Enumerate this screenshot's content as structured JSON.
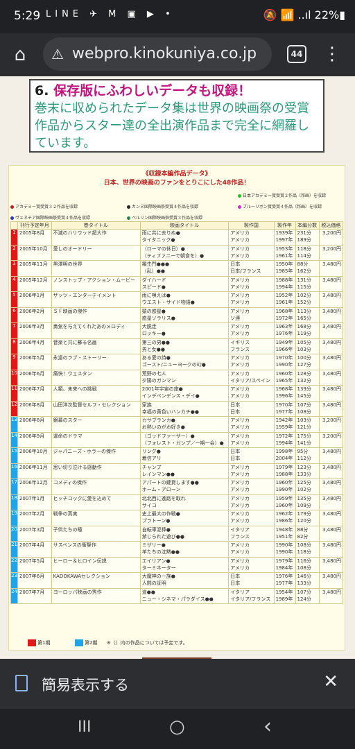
{
  "status": {
    "time": "5:29",
    "apps": "LINE ✈ M ▣ ▶ •",
    "right": "🔕 📶 ..ıl 22%▮"
  },
  "browser": {
    "url": "webpro.kinokuniya.co.jp",
    "tabs": "44"
  },
  "feature": {
    "num": "6.",
    "heading": "保存版にふわしいデータも収録！",
    "body": "巻末に収められたデータ集は世界の映画祭の受賞作品からスター達の全出演作品まで完全に網羅しています。"
  },
  "table": {
    "title1": "《収録本編作品データ》",
    "title2": "日本、世界の映画のファンをとりこにした48作品！",
    "legend": [
      {
        "color": "#22c322",
        "text": "日本アカデミー賞受賞２作品（邦画）を収録"
      },
      {
        "color": "#d01414",
        "text": "アカデミー賞受賞３２作品を収録"
      },
      {
        "color": "#222222",
        "text": "カンヌ国際映画祭受賞４作品を収録"
      },
      {
        "color": "#d02ad0",
        "text": "ブルーリボン賞受賞４作品（邦画）を収録"
      },
      {
        "color": "#1e3cc8",
        "text": "ヴェネチア国際映画祭受賞４作品を収録"
      },
      {
        "color": "#1e8a5a",
        "text": "ベルリン国際映画祭受賞３作品を収録"
      }
    ],
    "headers": [
      "",
      "刊行予定年月",
      "巻タイトル",
      "映画タイトル",
      "製作国",
      "製作年",
      "本編分数",
      "税込価格"
    ],
    "rows": [
      {
        "n": "1",
        "c": "r",
        "date": "2005年8月",
        "vol": "不滅のハリウッド超大作",
        "films": [
          "雨に共に去りぬ●",
          "タイタニック●"
        ],
        "country": [
          "アメリカ",
          "アメリカ"
        ],
        "year": [
          "1939年",
          "1997年"
        ],
        "mins": [
          "231分",
          "189分"
        ],
        "price": "3,200円"
      },
      {
        "n": "2",
        "c": "r",
        "date": "2005年10月",
        "vol": "愛しのオードリー",
        "films": [
          "（ローマの休日）●",
          "（ティファニーで朝食を）●"
        ],
        "country": [
          "アメリカ",
          "アメリカ"
        ],
        "year": [
          "1953年",
          "1961年"
        ],
        "mins": [
          "118分",
          "114分"
        ],
        "price": "3,200円"
      },
      {
        "n": "3",
        "c": "r",
        "date": "2005年11月",
        "vol": "黒澤明の世界",
        "films": [
          "羅生門●●●",
          "（乱）●●"
        ],
        "country": [
          "日本",
          "日本/フランス"
        ],
        "year": [
          "1950年",
          "1985年"
        ],
        "mins": [
          "88分",
          "162分"
        ],
        "price": "3,480円"
      },
      {
        "n": "4",
        "c": "r",
        "date": "2005年12月",
        "vol": "ノンストップ・アクション・ムービー",
        "films": [
          "ダイハード",
          "スピード●"
        ],
        "country": [
          "アメリカ",
          "アメリカ"
        ],
        "year": [
          "1988年",
          "1994年"
        ],
        "mins": [
          "131分",
          "115分"
        ],
        "price": "3,480円"
      },
      {
        "n": "5",
        "c": "r",
        "date": "2006年1月",
        "vol": "ザッツ・エンターテイメント",
        "films": [
          "雨に唄えば●",
          "ウエスト・サイド物語●"
        ],
        "country": [
          "アメリカ",
          "アメリカ"
        ],
        "year": [
          "1952年",
          "1961年"
        ],
        "mins": [
          "102分",
          "152分"
        ],
        "price": "3,480円"
      },
      {
        "n": "6",
        "c": "r",
        "date": "2006年2月",
        "vol": "ＳＦ映画の傑作",
        "films": [
          "猿の惑星●",
          "惑星ソラリス●"
        ],
        "country": [
          "アメリカ",
          "ソ連"
        ],
        "year": [
          "1968年",
          "1972年"
        ],
        "mins": [
          "113分",
          "165分"
        ],
        "price": "3,480円"
      },
      {
        "n": "7",
        "c": "r",
        "date": "2006年3月",
        "vol": "勇気を与えてくれたあのメロディ",
        "films": [
          "大脱走",
          "ロッキー●"
        ],
        "country": [
          "アメリカ",
          "アメリカ"
        ],
        "year": [
          "1963年",
          "1976年"
        ],
        "mins": [
          "168分",
          "119分"
        ],
        "price": "3,480円"
      },
      {
        "n": "8",
        "c": "r",
        "date": "2006年4月",
        "vol": "音楽と共に蘇る名画",
        "films": [
          "第三の男●●",
          "男と女●●"
        ],
        "country": [
          "イギリス",
          "フランス"
        ],
        "year": [
          "1949年",
          "1966年"
        ],
        "mins": [
          "105分",
          "103分"
        ],
        "price": "3,480円"
      },
      {
        "n": "9",
        "c": "r",
        "date": "2006年5月",
        "vol": "永遠のラブ・ストーリー",
        "films": [
          "ある愛の詩●",
          "ゴースト/ニューヨークの幻●"
        ],
        "country": [
          "アメリカ",
          "アメリカ"
        ],
        "year": [
          "1970年",
          "1990年"
        ],
        "mins": [
          "100分",
          "127分"
        ],
        "price": "3,480円"
      },
      {
        "n": "10",
        "c": "r",
        "date": "2006年6月",
        "vol": "痛快！ウェスタン",
        "films": [
          "荒野の七人",
          "夕陽のガンマン"
        ],
        "country": [
          "アメリカ",
          "イタリア/スペイン"
        ],
        "year": [
          "1960年",
          "1965年"
        ],
        "mins": [
          "128分",
          "132分"
        ],
        "price": "3,480円"
      },
      {
        "n": "11",
        "c": "r",
        "date": "2006年7月",
        "vol": "人類、未来への挑戦",
        "films": [
          "2001年宇宙の旅●",
          "インデペンデンス・デイ●"
        ],
        "country": [
          "アメリカ",
          "アメリカ"
        ],
        "year": [
          "1968年",
          "1996年"
        ],
        "mins": [
          "139分",
          "145分"
        ],
        "price": "3,480円"
      },
      {
        "n": "12",
        "c": "r",
        "date": "2006年8月",
        "vol": "山田洋次監督セルフ・セレクション",
        "films": [
          "家族",
          "幸福の黄色いハンカチ●●"
        ],
        "country": [
          "日本",
          "日本"
        ],
        "year": [
          "1970年",
          "1977年"
        ],
        "mins": [
          "107分",
          "108分"
        ],
        "price": "3,480円"
      },
      {
        "n": "13",
        "c": "b",
        "date": "2006年8月",
        "vol": "銀幕のスター",
        "films": [
          "カサブランカ●",
          "お熱いのがお好き●"
        ],
        "country": [
          "アメリカ",
          "アメリカ"
        ],
        "year": [
          "1942年",
          "1959年"
        ],
        "mins": [
          "103分",
          "121分"
        ],
        "price": "3,200円"
      },
      {
        "n": "14",
        "c": "b",
        "date": "2006年9月",
        "vol": "運命のドラマ",
        "films": [
          "（ゴッドファーザー）●",
          "（フォレスト・ガンプ／一期一会）●"
        ],
        "country": [
          "アメリカ",
          "アメリカ"
        ],
        "year": [
          "1972年",
          "1994年"
        ],
        "mins": [
          "175分",
          "141分"
        ],
        "price": "3,200円"
      },
      {
        "n": "15",
        "c": "b",
        "date": "2006年10月",
        "vol": "ジャパニーズ・ホラーの傑作",
        "films": [
          "リング●",
          "着信アリ"
        ],
        "country": [
          "日本",
          "日本"
        ],
        "year": [
          "1998年",
          "2004年"
        ],
        "mins": [
          "95分",
          "112分"
        ],
        "price": "3,480円"
      },
      {
        "n": "16",
        "c": "b",
        "date": "2006年11月",
        "vol": "思い切り泣ける感動作",
        "films": [
          "チャンプ",
          "レインマン●●"
        ],
        "country": [
          "アメリカ",
          "アメリカ"
        ],
        "year": [
          "1979年",
          "1988年"
        ],
        "mins": [
          "123分",
          "133分"
        ],
        "price": "3,480円"
      },
      {
        "n": "17",
        "c": "b",
        "date": "2006年12月",
        "vol": "コメディの傑作",
        "films": [
          "アパートの鍵貸します●●",
          "ホーム・アローン"
        ],
        "country": [
          "アメリカ",
          "アメリカ"
        ],
        "year": [
          "1960年",
          "1990年"
        ],
        "mins": [
          "125分",
          "102分"
        ],
        "price": "3,480円"
      },
      {
        "n": "18",
        "c": "b",
        "date": "2007年1月",
        "vol": "ヒッチコックに愛を込めて",
        "films": [
          "北北西に進路を取れ",
          "サイコ"
        ],
        "country": [
          "アメリカ",
          "アメリカ"
        ],
        "year": [
          "1959年",
          "1960年"
        ],
        "mins": [
          "135分",
          "109分"
        ],
        "price": "3,480円"
      },
      {
        "n": "19",
        "c": "b",
        "date": "2007年2月",
        "vol": "戦争の真実",
        "films": [
          "史上最大の作戦●",
          "プラトーン●"
        ],
        "country": [
          "アメリカ",
          "アメリカ"
        ],
        "year": [
          "1962年",
          "1986年"
        ],
        "mins": [
          "179分",
          "120分"
        ],
        "price": "3,480円"
      },
      {
        "n": "20",
        "c": "b",
        "date": "2007年3月",
        "vol": "子供たちの瞳",
        "films": [
          "自転車泥棒●",
          "禁じられた遊び●●"
        ],
        "country": [
          "イタリア",
          "フランス"
        ],
        "year": [
          "1948年",
          "1951年"
        ],
        "mins": [
          "88分",
          "82分"
        ],
        "price": "3,480円"
      },
      {
        "n": "21",
        "c": "b",
        "date": "2007年4月",
        "vol": "サスペンスの衝撃作",
        "films": [
          "ミザリー●",
          "羊たちの沈黙●●"
        ],
        "country": [
          "アメリカ",
          "アメリカ"
        ],
        "year": [
          "1990年",
          "1990年"
        ],
        "mins": [
          "108分",
          "118分"
        ],
        "price": "3,480円"
      },
      {
        "n": "22",
        "c": "b",
        "date": "2007年5月",
        "vol": "ヒーロー＆ヒロイン伝説",
        "films": [
          "エイリアン●",
          "ターミネーター"
        ],
        "country": [
          "アメリカ",
          "アメリカ"
        ],
        "year": [
          "1979年",
          "1984年"
        ],
        "mins": [
          "116分",
          "108分"
        ],
        "price": "3,480円"
      },
      {
        "n": "23",
        "c": "b",
        "date": "2007年6月",
        "vol": "KADOKAWAセレクション",
        "films": [
          "大魔神の一族●",
          "人間の証明"
        ],
        "country": [
          "日本",
          "日本"
        ],
        "year": [
          "1976年",
          "1977年"
        ],
        "mins": [
          "146分",
          "133分"
        ],
        "price": "3,480円"
      },
      {
        "n": "24",
        "c": "b",
        "date": "2007年7月",
        "vol": "ヨーロッパ映画の秀作",
        "films": [
          "道●●",
          "ニュー・シネマ・パラダイス●●"
        ],
        "country": [
          "イタリア",
          "イタリア/フランス"
        ],
        "year": [
          "1954年",
          "1989年"
        ],
        "mins": [
          "107分",
          "124分"
        ],
        "price": "3,480円"
      }
    ],
    "footer": {
      "first": "第1期",
      "second": "第2期",
      "note": "※（）内の作品については予定です。"
    }
  },
  "snackbar": {
    "label": "簡易表示する"
  },
  "nav": {
    "recent": "III",
    "home": "○",
    "back": "‹"
  },
  "colors": {
    "period1": "#e01818",
    "period2": "#21a3e8",
    "heading": "#c2167e",
    "body": "#2a9a7a"
  }
}
